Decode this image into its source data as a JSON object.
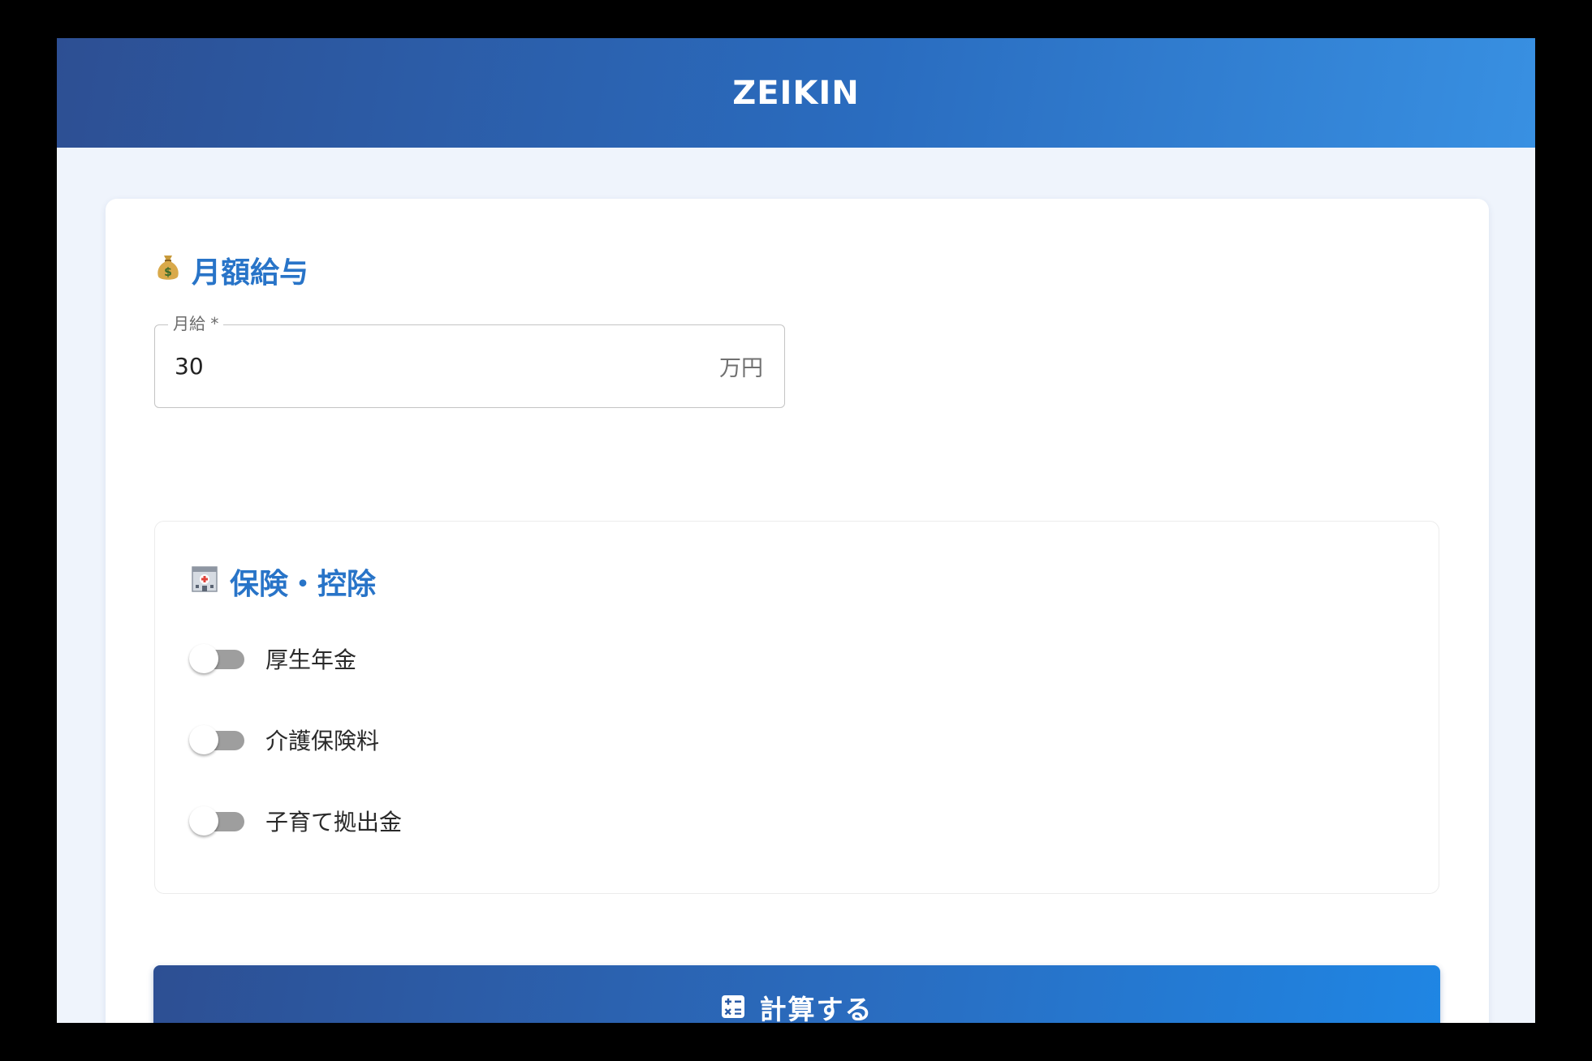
{
  "app": {
    "title": "ZEIKIN"
  },
  "salary_section": {
    "heading": "月額給与",
    "heading_icon": "money-bag-icon",
    "field": {
      "label": "月給 *",
      "value": "30",
      "unit": "万円"
    }
  },
  "insurance_section": {
    "heading": "保険・控除",
    "heading_icon": "hospital-icon",
    "toggles": [
      {
        "label": "厚生年金",
        "checked": false
      },
      {
        "label": "介護保険料",
        "checked": false
      },
      {
        "label": "子育て拠出金",
        "checked": false
      }
    ]
  },
  "calculate_button": {
    "label": "計算する",
    "icon": "calculator-icon"
  },
  "colors": {
    "accent": "#2874c8",
    "header_gradient_start": "#2d4f93",
    "header_gradient_end": "#3890e2",
    "background": "#eff4fc",
    "toggle_off": "#9e9e9e"
  }
}
